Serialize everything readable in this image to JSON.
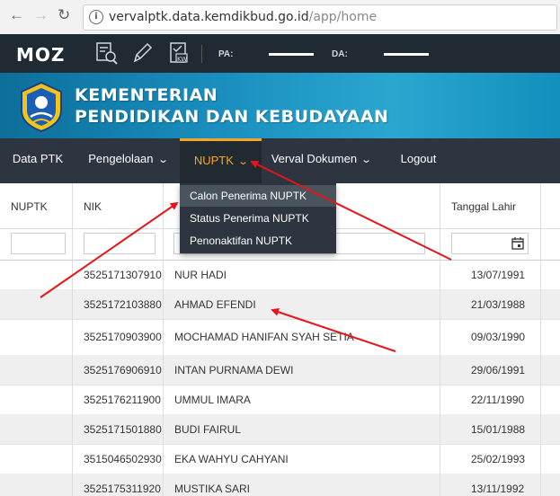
{
  "browser": {
    "url_host": "vervalptk.data.kemdikbud.go.id",
    "url_path": "/app/home",
    "info_glyph": "i"
  },
  "moz_bar": {
    "logo": "MOZ",
    "pa_label": "PA:",
    "da_label": "DA:"
  },
  "banner": {
    "line1": "KEMENTERIAN",
    "line2": "PENDIDIKAN DAN KEBUDAYAAN"
  },
  "menu": {
    "items": [
      {
        "label": "Data PTK"
      },
      {
        "label": "Pengelolaan"
      },
      {
        "label": "NUPTK"
      },
      {
        "label": "Verval Dokumen"
      },
      {
        "label": "Logout"
      }
    ],
    "accent": "#f5a623"
  },
  "dropdown": {
    "items": [
      {
        "label": "Calon Penerima NUPTK"
      },
      {
        "label": "Status Penerima NUPTK"
      },
      {
        "label": "Penonaktifan NUPTK"
      }
    ]
  },
  "table": {
    "headers": {
      "nuptk": "NUPTK",
      "nik": "NIK",
      "tanggal_lahir": "Tanggal Lahir"
    },
    "rows": [
      {
        "nik": "3525171307910",
        "nama": "NUR HADI",
        "tgl": "13/07/1991"
      },
      {
        "nik": "3525172103880",
        "nama": "AHMAD EFENDI",
        "tgl": "21/03/1988"
      },
      {
        "nik": "3525170903900",
        "nama": "MOCHAMAD HANIFAN SYAH SETIA",
        "tgl": "09/03/1990"
      },
      {
        "nik": "3525176906910",
        "nama": "INTAN PURNAMA DEWI",
        "tgl": "29/06/1991"
      },
      {
        "nik": "3525176211900",
        "nama": "UMMUL IMARA",
        "tgl": "22/11/1990"
      },
      {
        "nik": "3525171501880",
        "nama": "BUDI FAIRUL",
        "tgl": "15/01/1988"
      },
      {
        "nik": "3515046502930",
        "nama": "EKA WAHYU CAHYANI",
        "tgl": "25/02/1993"
      },
      {
        "nik": "3525175311920",
        "nama": "MUSTIKA SARI",
        "tgl": "13/11/1992"
      }
    ]
  },
  "annotation_color": "#e8141b"
}
